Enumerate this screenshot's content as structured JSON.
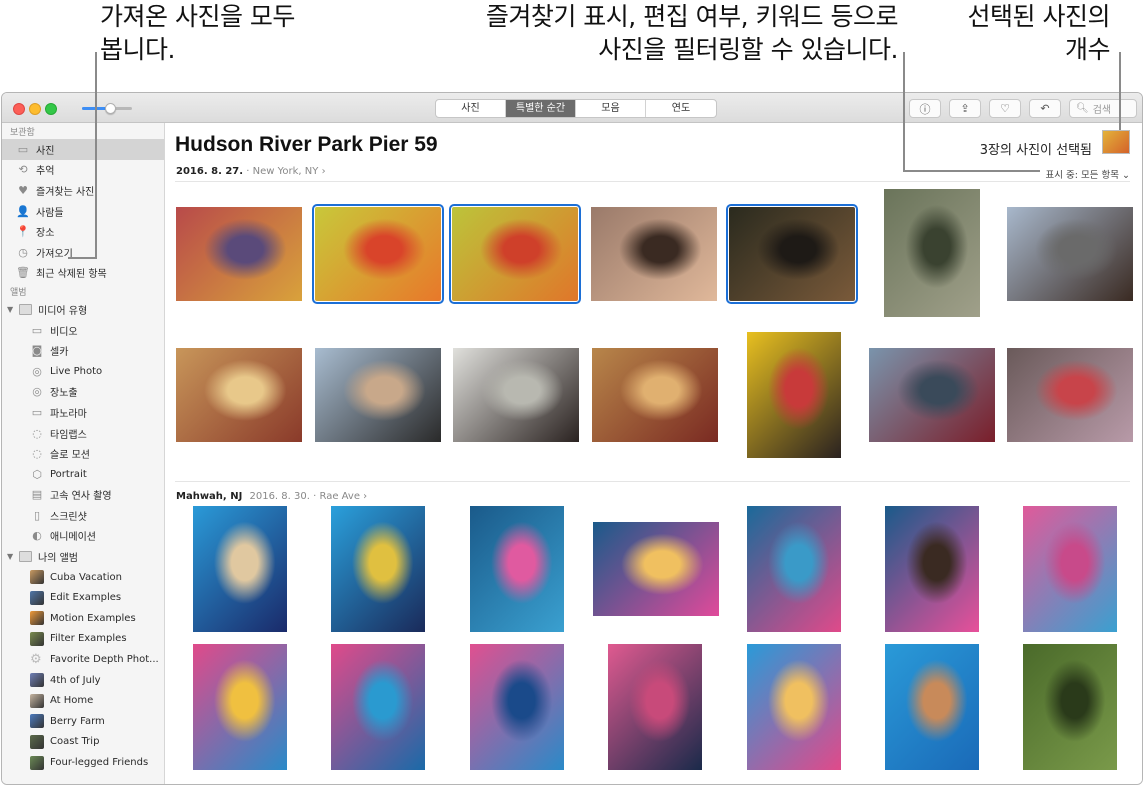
{
  "callouts": {
    "imports": [
      "가져온 사진을 모두",
      "봅니다."
    ],
    "filter": [
      "즐겨찾기 표시, 편집 여부, 키워드 등으로",
      "사진을 필터링할 수 있습니다."
    ],
    "selected": [
      "선택된 사진의",
      "개수"
    ]
  },
  "toolbar": {
    "zoom_level": 0.55,
    "view_tabs": [
      {
        "label": "사진",
        "active": false
      },
      {
        "label": "특별한 순간",
        "active": true
      },
      {
        "label": "모음",
        "active": false
      },
      {
        "label": "연도",
        "active": false
      }
    ],
    "buttons": [
      {
        "name": "info-button",
        "icon": "info-icon",
        "glyph": "ⓘ"
      },
      {
        "name": "share-button",
        "icon": "share-icon",
        "glyph": "⇪"
      },
      {
        "name": "favorite-button",
        "icon": "heart-icon",
        "glyph": "♡"
      },
      {
        "name": "rotate-button",
        "icon": "rotate-icon",
        "glyph": "↶"
      }
    ],
    "search_placeholder": "검색"
  },
  "sidebar": {
    "library_header": "보관함",
    "library": [
      {
        "label": "사진",
        "icon": "photos-icon",
        "glyph": "▭",
        "selected": true
      },
      {
        "label": "추억",
        "icon": "memories-icon",
        "glyph": "⟲"
      },
      {
        "label": "즐겨찾는 사진",
        "icon": "heart-icon",
        "glyph": "♥"
      },
      {
        "label": "사람들",
        "icon": "person-icon",
        "glyph": "👤"
      },
      {
        "label": "장소",
        "icon": "pin-icon",
        "glyph": "📍"
      },
      {
        "label": "가져오기",
        "icon": "clock-icon",
        "glyph": "◷"
      },
      {
        "label": "최근 삭제된 항목",
        "icon": "trash-icon",
        "glyph": "🗑"
      }
    ],
    "albums_header": "앨범",
    "media_types_label": "미디어 유형",
    "media_types": [
      {
        "label": "비디오",
        "icon": "video-icon",
        "glyph": "▭"
      },
      {
        "label": "셀카",
        "icon": "selfie-icon",
        "glyph": "◙"
      },
      {
        "label": "Live Photo",
        "icon": "live-photo-icon",
        "glyph": "◎"
      },
      {
        "label": "장노출",
        "icon": "long-exposure-icon",
        "glyph": "◎"
      },
      {
        "label": "파노라마",
        "icon": "panorama-icon",
        "glyph": "▭"
      },
      {
        "label": "타임랩스",
        "icon": "timelapse-icon",
        "glyph": "◌"
      },
      {
        "label": "슬로 모션",
        "icon": "slomo-icon",
        "glyph": "◌"
      },
      {
        "label": "Portrait",
        "icon": "portrait-cube-icon",
        "glyph": "⬡"
      },
      {
        "label": "고속 연사 촬영",
        "icon": "burst-icon",
        "glyph": "▤"
      },
      {
        "label": "스크린샷",
        "icon": "screenshot-icon",
        "glyph": "▯"
      },
      {
        "label": "애니메이션",
        "icon": "animated-icon",
        "glyph": "◐"
      }
    ],
    "my_albums_label": "나의 앨범",
    "my_albums": [
      {
        "label": "Cuba Vacation",
        "color": "#c99a62"
      },
      {
        "label": "Edit Examples",
        "color": "#4f76a8"
      },
      {
        "label": "Motion Examples",
        "color": "#ef9a3a"
      },
      {
        "label": "Filter Examples",
        "color": "#7a8c4f"
      },
      {
        "label": "Favorite Depth Phot...",
        "color": "gear"
      },
      {
        "label": "4th of July",
        "color": "#6f7fb6"
      },
      {
        "label": "At Home",
        "color": "#c5b4a0"
      },
      {
        "label": "Berry Farm",
        "color": "#4c7bbf"
      },
      {
        "label": "Coast Trip",
        "color": "#5b6b4a"
      },
      {
        "label": "Four-legged Friends",
        "color": "#6b8a55"
      }
    ]
  },
  "moment1": {
    "title": "Hudson River Park Pier 59",
    "date": "2016. 8. 27.",
    "location": "New York, NY",
    "selected_count_text": "3장의 사진이 선택됨",
    "filter_text": "표시 중: 모든 항목"
  },
  "moment2": {
    "location": "Mahwah, NJ",
    "date": "2016. 8. 30.",
    "place": "Rae Ave"
  },
  "photos": [
    {
      "row": 1,
      "desc": "woman by striped wall",
      "colors": [
        "#b84a4a",
        "#d9a23b",
        "#5a4a7a"
      ],
      "selected": false
    },
    {
      "row": 1,
      "desc": "man with flying braids, yellow wall",
      "colors": [
        "#c8c83a",
        "#e8782a",
        "#d9442a"
      ],
      "selected": true
    },
    {
      "row": 1,
      "desc": "man hair flip, orange wall",
      "colors": [
        "#bcc43a",
        "#e0762a",
        "#cf402a"
      ],
      "selected": true
    },
    {
      "row": 1,
      "desc": "man with glasses, bokeh",
      "colors": [
        "#9a7a6a",
        "#e0b89a",
        "#3a2a22"
      ],
      "selected": false
    },
    {
      "row": 1,
      "desc": "woman curly hair backlit",
      "colors": [
        "#2a2a1e",
        "#7a5a3a",
        "#1e1a16"
      ],
      "selected": true
    },
    {
      "row": 1,
      "desc": "shadow on turf",
      "colors": [
        "#6a745a",
        "#a0a08a",
        "#3a4230"
      ],
      "selected": false
    },
    {
      "row": 1,
      "desc": "man with blue sunglasses",
      "colors": [
        "#a8b8cc",
        "#3a2a22",
        "#6a6a6a"
      ],
      "selected": false
    },
    {
      "row": 2,
      "desc": "woman braid bokeh",
      "colors": [
        "#c8965a",
        "#8a3a2a",
        "#e8c88a"
      ],
      "selected": false
    },
    {
      "row": 2,
      "desc": "man smiling sunglasses",
      "colors": [
        "#a8bcd0",
        "#2a2a2a",
        "#c8a88a"
      ],
      "selected": false
    },
    {
      "row": 2,
      "desc": "woman white wall",
      "colors": [
        "#e0e0dc",
        "#2a2220",
        "#b8b8b0"
      ],
      "selected": false
    },
    {
      "row": 2,
      "desc": "woman red top bokeh",
      "colors": [
        "#b8864a",
        "#7a2a22",
        "#e0b070"
      ],
      "selected": false
    },
    {
      "row": 2,
      "desc": "woman yellow shutter",
      "colors": [
        "#e8c020",
        "#2a2220",
        "#c83a3a"
      ],
      "selected": false
    },
    {
      "row": 2,
      "desc": "woman red jacket skyline",
      "colors": [
        "#7a94ac",
        "#7a1e2a",
        "#3a4a5a"
      ],
      "selected": false
    },
    {
      "row": 2,
      "desc": "woman lavender hair",
      "colors": [
        "#6a5a5a",
        "#b89aa8",
        "#c8444a"
      ],
      "selected": false
    },
    {
      "row": 3,
      "desc": "woman hat pool float",
      "colors": [
        "#2a9ad8",
        "#1a2a6a",
        "#e0c8a0"
      ],
      "selected": false
    },
    {
      "row": 3,
      "desc": "woman sunglasses pool float",
      "colors": [
        "#2aa0dc",
        "#1a2a5a",
        "#e0c040"
      ],
      "selected": false
    },
    {
      "row": 3,
      "desc": "pool popsicle float",
      "colors": [
        "#1a5a8a",
        "#3aa0d0",
        "#e05aa0"
      ],
      "selected": false
    },
    {
      "row": 3,
      "desc": "donut float",
      "colors": [
        "#1a5a8a",
        "#e04a9a",
        "#f0c060"
      ],
      "selected": false
    },
    {
      "row": 3,
      "desc": "donut float two",
      "colors": [
        "#1a6a9a",
        "#e04a8a",
        "#3a9ac8"
      ],
      "selected": false
    },
    {
      "row": 3,
      "desc": "donut float overhead",
      "colors": [
        "#1a5a8a",
        "#e8509a",
        "#3a2a22"
      ],
      "selected": false
    },
    {
      "row": 3,
      "desc": "flamingo float",
      "colors": [
        "#e05a9a",
        "#3aa0d0",
        "#c84a8a"
      ],
      "selected": false
    },
    {
      "row": 4,
      "desc": "flamingo beach ball",
      "colors": [
        "#e04a8a",
        "#2a8ac8",
        "#f0c040"
      ],
      "selected": false
    },
    {
      "row": 4,
      "desc": "girls on flamingo",
      "colors": [
        "#e04a8a",
        "#1a6aa8",
        "#2a9ad0"
      ],
      "selected": false
    },
    {
      "row": 4,
      "desc": "girls smiling flamingo",
      "colors": [
        "#e05090",
        "#2a8ac8",
        "#1a4a8a"
      ],
      "selected": false
    },
    {
      "row": 4,
      "desc": "boy on flamingo",
      "colors": [
        "#e05a90",
        "#1a2a4a",
        "#c84a7a"
      ],
      "selected": false
    },
    {
      "row": 4,
      "desc": "donut float kids",
      "colors": [
        "#2a9ad8",
        "#e04a8a",
        "#f0c060"
      ],
      "selected": false
    },
    {
      "row": 4,
      "desc": "boy swimming",
      "colors": [
        "#2a9ad8",
        "#1a6ab8",
        "#c88a5a"
      ],
      "selected": false
    },
    {
      "row": 4,
      "desc": "bubbles on lawn",
      "colors": [
        "#4a6a2a",
        "#7a9a4a",
        "#2a3a1a"
      ],
      "selected": false
    }
  ]
}
